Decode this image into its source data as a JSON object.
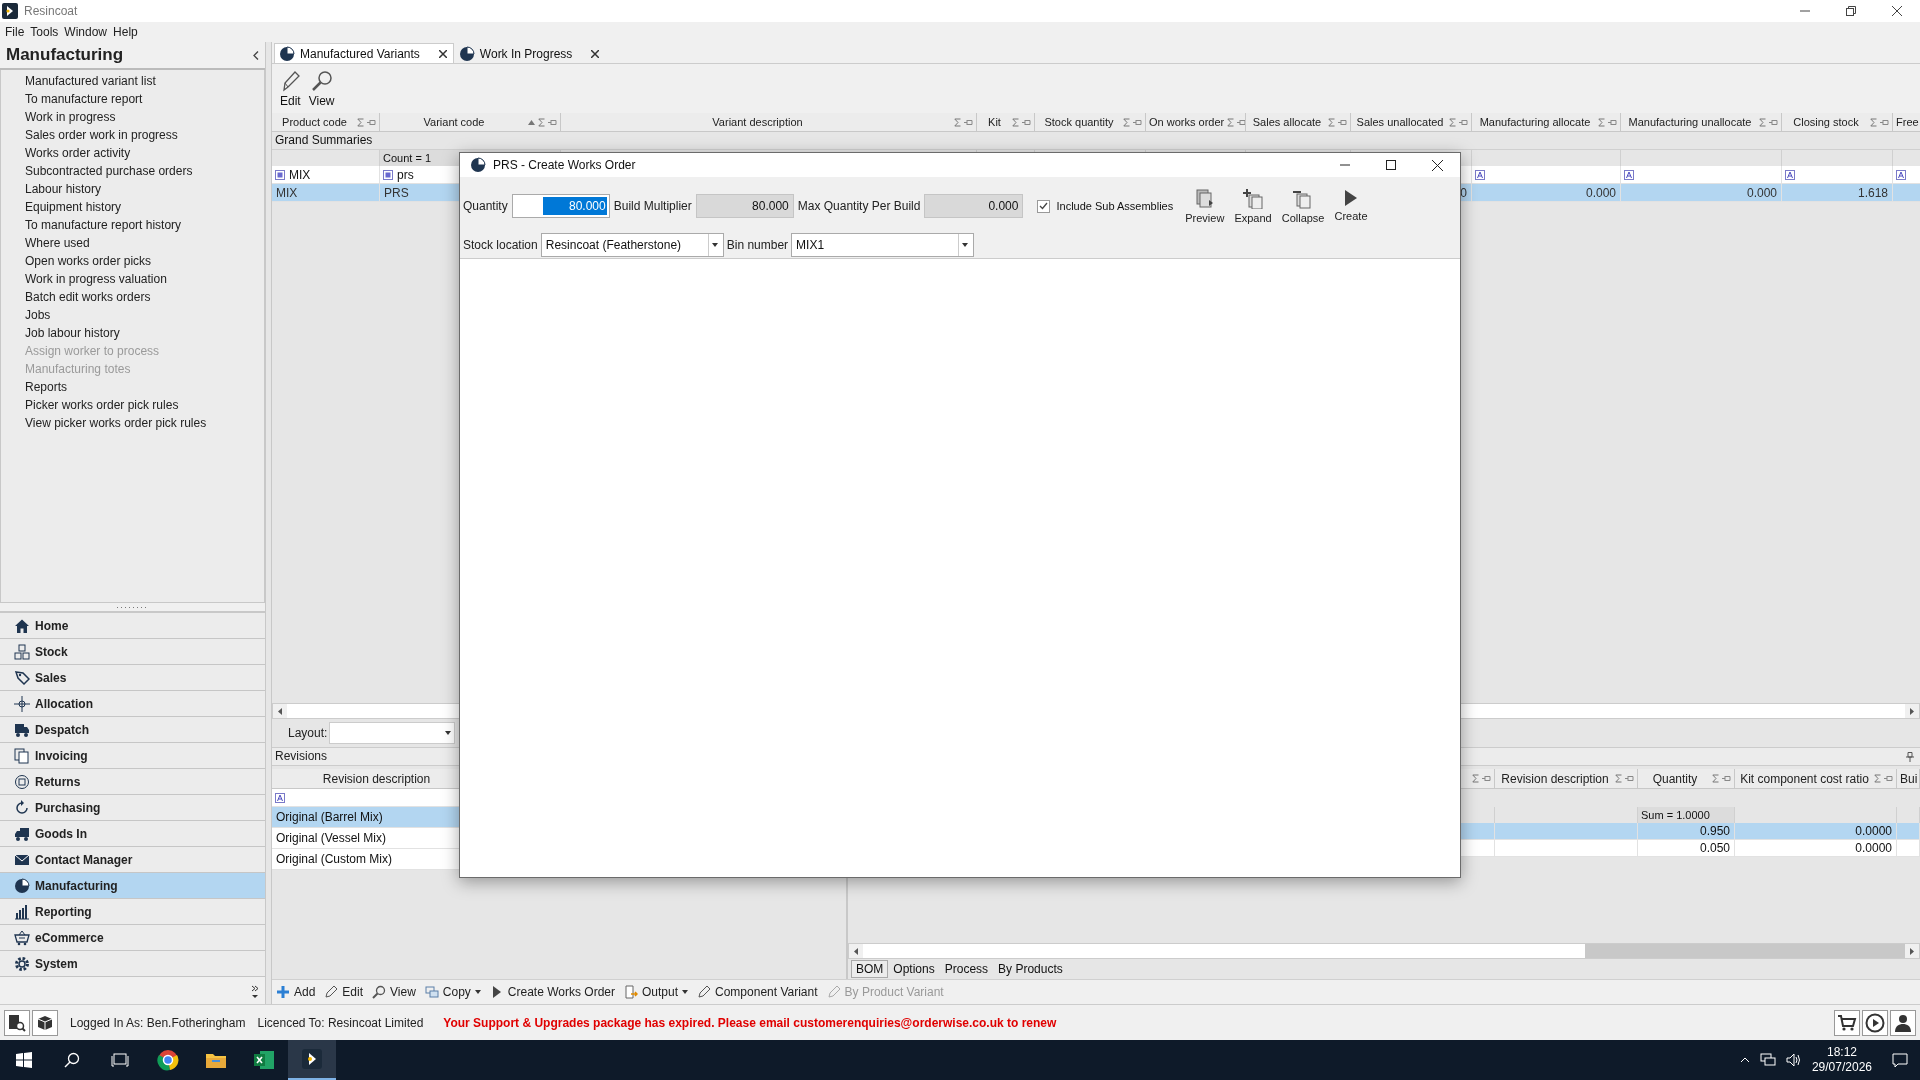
{
  "window": {
    "title": "Resincoat"
  },
  "menu": [
    "File",
    "Tools",
    "Window",
    "Help"
  ],
  "sidebar": {
    "title": "Manufacturing",
    "links": [
      {
        "label": "Manufactured variant list",
        "disabled": false
      },
      {
        "label": "To manufacture report",
        "disabled": false
      },
      {
        "label": "Work in progress",
        "disabled": false
      },
      {
        "label": "Sales order work in progress",
        "disabled": false
      },
      {
        "label": "Works order activity",
        "disabled": false
      },
      {
        "label": "Subcontracted purchase orders",
        "disabled": false
      },
      {
        "label": "Labour history",
        "disabled": false
      },
      {
        "label": "Equipment history",
        "disabled": false
      },
      {
        "label": "To manufacture report history",
        "disabled": false
      },
      {
        "label": "Where used",
        "disabled": false
      },
      {
        "label": "Open works order picks",
        "disabled": false
      },
      {
        "label": "Work in progress valuation",
        "disabled": false
      },
      {
        "label": "Batch edit works orders",
        "disabled": false
      },
      {
        "label": "Jobs",
        "disabled": false
      },
      {
        "label": "Job labour history",
        "disabled": false
      },
      {
        "label": "Assign worker to process",
        "disabled": true
      },
      {
        "label": "Manufacturing totes",
        "disabled": true
      },
      {
        "label": "Reports",
        "disabled": false
      },
      {
        "label": "Picker works order pick rules",
        "disabled": false
      },
      {
        "label": "View picker works order pick rules",
        "disabled": false
      }
    ],
    "nav": [
      {
        "label": "Home",
        "selected": false
      },
      {
        "label": "Stock",
        "selected": false
      },
      {
        "label": "Sales",
        "selected": false
      },
      {
        "label": "Allocation",
        "selected": false
      },
      {
        "label": "Despatch",
        "selected": false
      },
      {
        "label": "Invoicing",
        "selected": false
      },
      {
        "label": "Returns",
        "selected": false
      },
      {
        "label": "Purchasing",
        "selected": false
      },
      {
        "label": "Goods In",
        "selected": false
      },
      {
        "label": "Contact Manager",
        "selected": false
      },
      {
        "label": "Manufacturing",
        "selected": true
      },
      {
        "label": "Reporting",
        "selected": false
      },
      {
        "label": "eCommerce",
        "selected": false
      },
      {
        "label": "System",
        "selected": false
      }
    ]
  },
  "tabs": [
    {
      "label": "Manufactured Variants",
      "selected": true
    },
    {
      "label": "Work In Progress",
      "selected": false
    }
  ],
  "toolbar": [
    "Edit",
    "View"
  ],
  "grid": {
    "columns": [
      {
        "label": "Product code",
        "filter": {
          "kind": "list",
          "value": "MIX"
        },
        "cells": [
          "MIX"
        ]
      },
      {
        "label": "Variant code",
        "sorted_ascending": true,
        "summary": "Count = 1",
        "filter": {
          "kind": "list",
          "value": "prs"
        },
        "cells": [
          "PRS"
        ]
      },
      {
        "label": "Variant description"
      },
      {
        "label": "Kit"
      },
      {
        "label": "Stock quantity"
      },
      {
        "label": "On works order"
      },
      {
        "label": "Sales allocate"
      },
      {
        "label": "Sales unallocated",
        "cells": [
          "0"
        ]
      },
      {
        "label": "Manufacturing allocate",
        "filter": {
          "kind": "text"
        },
        "cells": [
          "0.000"
        ]
      },
      {
        "label": "Manufacturing unallocate",
        "filter": {
          "kind": "text"
        },
        "cells": [
          "0.000"
        ]
      },
      {
        "label": "Closing stock",
        "filter": {
          "kind": "text"
        },
        "cells": [
          "1.618"
        ]
      },
      {
        "label": "Free",
        "filter": {
          "kind": "text"
        }
      }
    ],
    "group_title": "Grand Summaries",
    "rows": [
      {
        "selected": true
      }
    ]
  },
  "layout": {
    "label": "Layout:"
  },
  "revisions": {
    "title": "Revisions",
    "columns": [
      {
        "label": "Revision description",
        "filter": {
          "kind": "text"
        }
      }
    ],
    "rows": [
      {
        "selected": true,
        "label": "Original (Barrel Mix)"
      },
      {
        "selected": false,
        "label": "Original (Vessel Mix)"
      },
      {
        "selected": false,
        "label": "Original (Custom Mix)"
      }
    ]
  },
  "components": {
    "columns": [
      {
        "label": "Revision description"
      },
      {
        "label": "Quantity",
        "summary": "Sum = 1.0000",
        "cells": [
          "0.950",
          "0.050"
        ]
      },
      {
        "label": "Kit component cost ratio",
        "cells": [
          "0.0000",
          "0.0000"
        ]
      },
      {
        "label": "Bui"
      }
    ],
    "rows": [
      {
        "selected": true
      },
      {
        "selected": false
      }
    ]
  },
  "bottom_tabs": [
    {
      "label": "BOM",
      "selected": true
    },
    {
      "label": "Options",
      "selected": false
    },
    {
      "label": "Process",
      "selected": false
    },
    {
      "label": "By Products",
      "selected": false
    }
  ],
  "actions": [
    {
      "label": "Add",
      "disabled": false,
      "dropdown": false
    },
    {
      "label": "Edit",
      "disabled": false,
      "dropdown": false
    },
    {
      "label": "View",
      "disabled": false,
      "dropdown": false
    },
    {
      "label": "Copy",
      "disabled": false,
      "dropdown": true
    },
    {
      "label": "Create Works Order",
      "disabled": false,
      "dropdown": false
    },
    {
      "label": "Output",
      "disabled": false,
      "dropdown": true
    },
    {
      "label": "Component Variant",
      "disabled": false,
      "dropdown": false
    },
    {
      "label": "By Product Variant",
      "disabled": true,
      "dropdown": false
    }
  ],
  "status": {
    "user": "Logged In As: Ben.Fotheringham",
    "licence": "Licenced To: Resincoat Limited",
    "message": "Your Support & Upgrades package has expired. Please email customerenquiries@orderwise.co.uk to renew"
  },
  "taskbar": {
    "time": "18:12",
    "date": "29/07/2026"
  },
  "dialog": {
    "title": "PRS - Create Works Order",
    "quantity": {
      "label": "Quantity",
      "value": "80.000"
    },
    "build_multiplier": {
      "label": "Build Multiplier",
      "value": "80.000"
    },
    "max_quantity": {
      "label": "Max Quantity Per Build",
      "value": "0.000"
    },
    "include_sub_assemblies": {
      "label": "Include Sub Assemblies",
      "checked": true
    },
    "buttons": [
      "Preview",
      "Expand",
      "Collapse",
      "Create"
    ],
    "stock_location": {
      "label": "Stock location",
      "value": "Resincoat (Featherstone)"
    },
    "bin_number": {
      "label": "Bin number",
      "value": "MIX1"
    }
  }
}
